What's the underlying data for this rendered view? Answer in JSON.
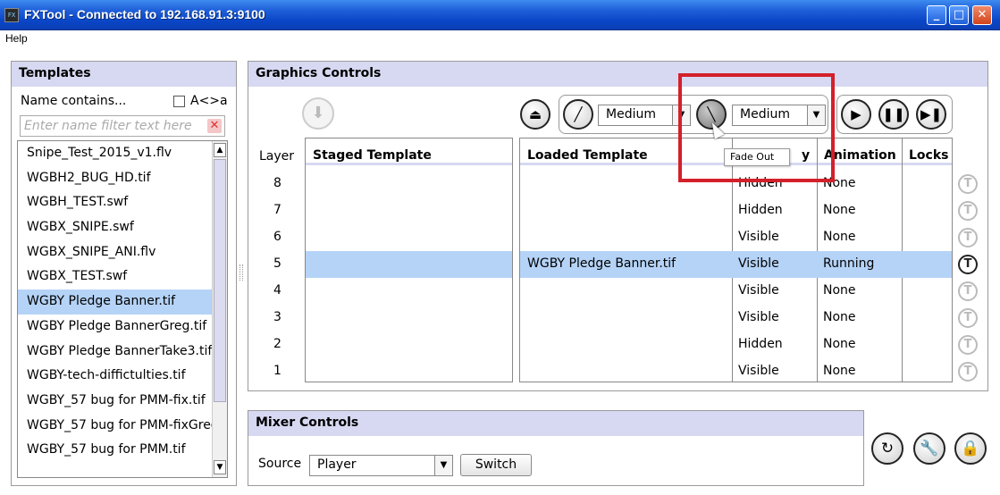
{
  "window": {
    "title": "FXTool - Connected to 192.168.91.3:9100",
    "icon_label": "FX",
    "controls": [
      "minimize-icon",
      "maximize-icon",
      "close-icon"
    ]
  },
  "menu": {
    "help": "Help"
  },
  "templates": {
    "header": "Templates",
    "name_contains": "Name contains...",
    "case_checkbox_label": "A<>a",
    "case_checked": false,
    "filter_placeholder": "Enter name filter text here",
    "filter_value": "",
    "items": [
      "Snipe_Test_2015_v1.flv",
      "WGBH2_BUG_HD.tif",
      "WGBH_TEST.swf",
      "WGBX_SNIPE.swf",
      "WGBX_SNIPE_ANI.flv",
      "WGBX_TEST.swf",
      "WGBY Pledge Banner.tif",
      "WGBY Pledge BannerGreg.tif",
      "WGBY Pledge BannerTake3.tif",
      "WGBY-tech-diffictulties.tif",
      "WGBY_57 bug for PMM-fix.tif",
      "WGBY_57 bug for PMM-fixGreg.tif",
      "WGBY_57 bug for PMM.tif"
    ],
    "selected_index": 6
  },
  "graphics": {
    "header": "Graphics Controls",
    "fade_in_speed": "Medium",
    "fade_out_speed": "Medium",
    "tooltip": "Fade Out",
    "columns": {
      "layer": "Layer",
      "staged": "Staged Template",
      "loaded": "Loaded Template",
      "visibility": "y",
      "animation": "Animation",
      "locks": "Locks"
    },
    "rows": [
      {
        "layer": "8",
        "staged": "",
        "loaded": "",
        "visibility": "Hidden",
        "animation": "None",
        "locked": false
      },
      {
        "layer": "7",
        "staged": "",
        "loaded": "",
        "visibility": "Hidden",
        "animation": "None",
        "locked": false
      },
      {
        "layer": "6",
        "staged": "",
        "loaded": "",
        "visibility": "Visible",
        "animation": "None",
        "locked": false
      },
      {
        "layer": "5",
        "staged": "",
        "loaded": "WGBY Pledge Banner.tif",
        "visibility": "Visible",
        "animation": "Running",
        "locked": true
      },
      {
        "layer": "4",
        "staged": "",
        "loaded": "",
        "visibility": "Visible",
        "animation": "None",
        "locked": false
      },
      {
        "layer": "3",
        "staged": "",
        "loaded": "",
        "visibility": "Visible",
        "animation": "None",
        "locked": false
      },
      {
        "layer": "2",
        "staged": "",
        "loaded": "",
        "visibility": "Hidden",
        "animation": "None",
        "locked": false
      },
      {
        "layer": "1",
        "staged": "",
        "loaded": "",
        "visibility": "Visible",
        "animation": "None",
        "locked": false
      }
    ],
    "lock_letter": "T"
  },
  "mixer": {
    "header": "Mixer Controls",
    "source_label": "Source",
    "source_value": "Player",
    "switch_label": "Switch"
  },
  "colors": {
    "titlebar": "#0a46c8",
    "panel_header": "#d7d9f2",
    "selection": "#b5d3f7",
    "highlight_box": "#d4202a"
  }
}
